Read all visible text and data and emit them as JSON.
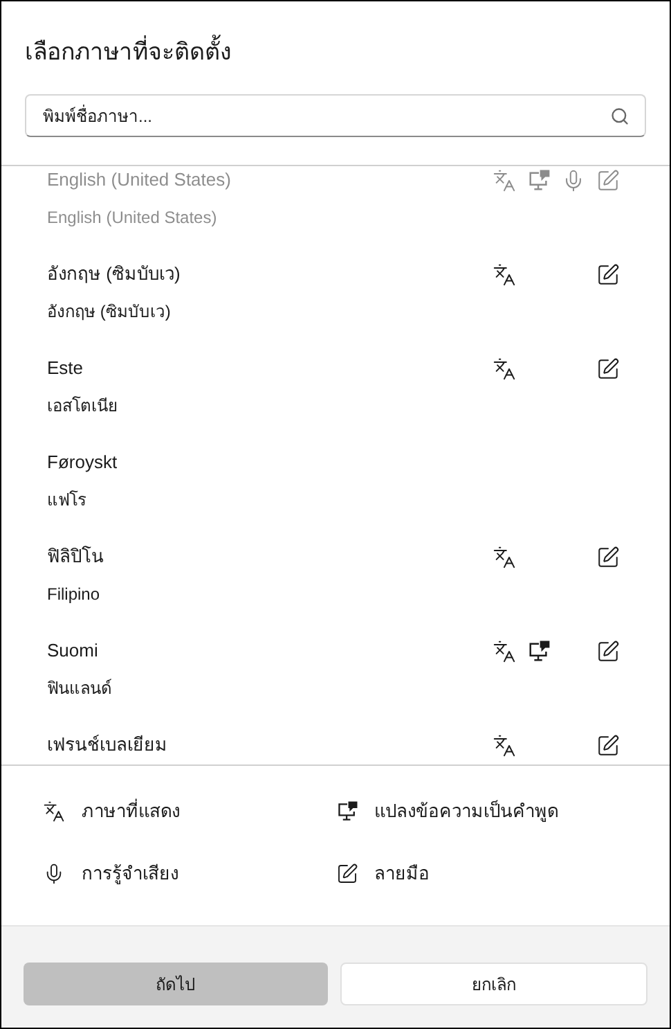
{
  "title": "เลือกภาษาที่จะติดตั้ง",
  "search": {
    "placeholder": "พิมพ์ชื่อภาษา..."
  },
  "languages": [
    {
      "name": "English (United States)",
      "subtitle": "English (United States)",
      "faded": true,
      "display": true,
      "tts": true,
      "speech": true,
      "handwriting": true
    },
    {
      "name": "อังกฤษ (ซิมบับเว)",
      "subtitle": "อังกฤษ (ซิมบับเว)",
      "faded": false,
      "display": true,
      "tts": false,
      "speech": false,
      "handwriting": true
    },
    {
      "name": "Este",
      "subtitle": "เอสโตเนีย",
      "faded": false,
      "display": true,
      "tts": false,
      "speech": false,
      "handwriting": true
    },
    {
      "name": "Føroyskt",
      "subtitle": "แฟโร",
      "faded": false,
      "display": false,
      "tts": false,
      "speech": false,
      "handwriting": false
    },
    {
      "name": "ฟิลิปิโน",
      "subtitle": "Filipino",
      "faded": false,
      "display": true,
      "tts": false,
      "speech": false,
      "handwriting": true
    },
    {
      "name": "Suomi",
      "subtitle": "ฟินแลนด์",
      "faded": false,
      "display": true,
      "tts": true,
      "speech": false,
      "handwriting": true
    },
    {
      "name": "เฟรนช์เบลเยียม",
      "faded": false,
      "display": true,
      "tts": false,
      "speech": false,
      "handwriting": true
    }
  ],
  "legend": [
    {
      "kind": "display",
      "label": "ภาษาที่แสดง"
    },
    {
      "kind": "tts",
      "label": "แปลงข้อความเป็นคำพูด"
    },
    {
      "kind": "speech",
      "label": "การรู้จำเสียง"
    },
    {
      "kind": "handwriting",
      "label": "ลายมือ"
    }
  ],
  "buttons": [
    {
      "kind": "primary",
      "label": "ถัดไป",
      "disabled": true
    },
    {
      "kind": "secondary",
      "label": "ยกเลิก",
      "disabled": false
    }
  ]
}
